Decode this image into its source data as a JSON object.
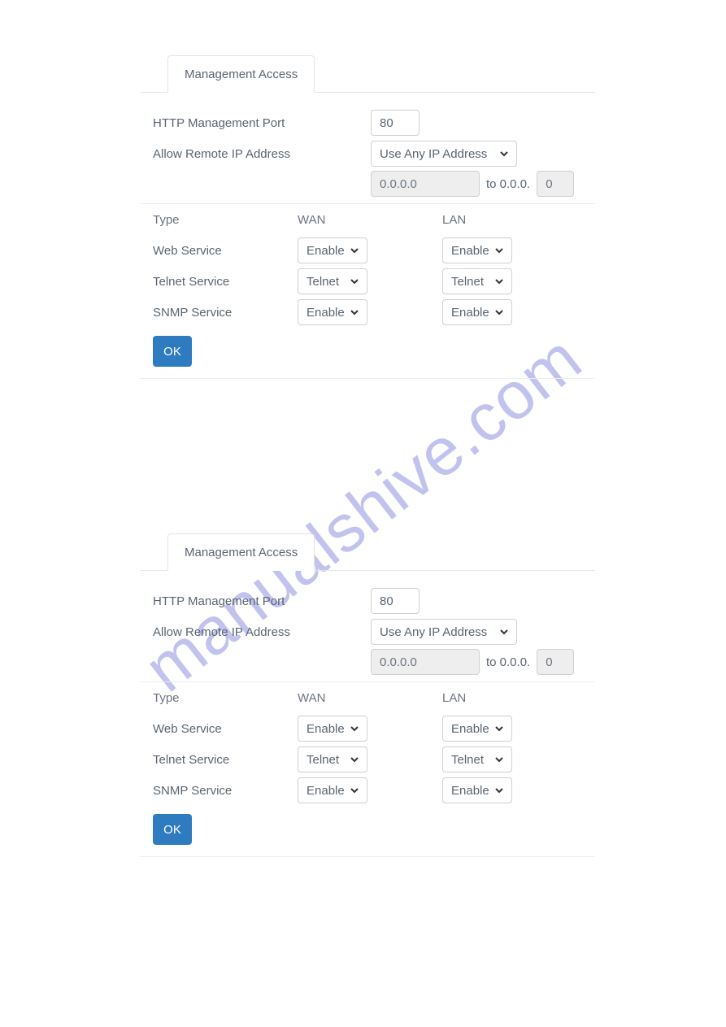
{
  "watermark": "manualshive.com",
  "panel": {
    "tab": "Management Access",
    "http_port_label": "HTTP Management Port",
    "http_port_value": "80",
    "allow_ip_label": "Allow Remote IP Address",
    "allow_ip_value": "Use Any IP Address",
    "range_from": "0.0.0.0",
    "range_to_label": "to 0.0.0.",
    "range_to_value": "0",
    "type_header": "Type",
    "wan_header": "WAN",
    "lan_header": "LAN",
    "services": [
      {
        "name": "Web Service",
        "wan": "Enable",
        "lan": "Enable"
      },
      {
        "name": "Telnet Service",
        "wan": "Telnet",
        "lan": "Telnet"
      },
      {
        "name": "SNMP Service",
        "wan": "Enable",
        "lan": "Enable"
      }
    ],
    "ok_label": "OK"
  }
}
